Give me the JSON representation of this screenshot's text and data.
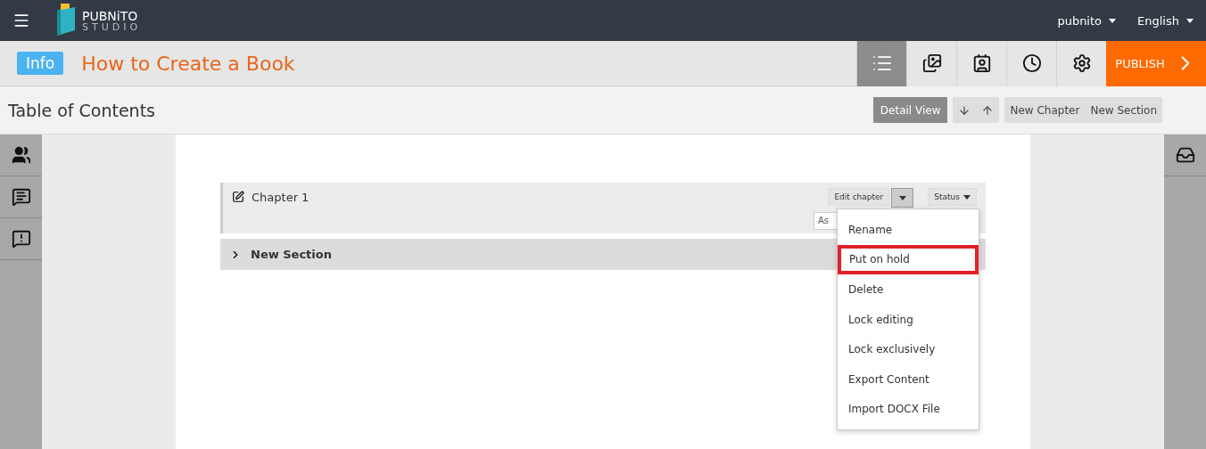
{
  "app": {
    "logo_line1": "PUBNiTO",
    "logo_line2": "STUDIO",
    "user_menu": "pubnito",
    "language_menu": "English"
  },
  "header": {
    "badge": "Info",
    "title": "How to Create a Book",
    "tools": [
      {
        "kind": "list",
        "selected": true
      },
      {
        "kind": "images",
        "selected": false
      },
      {
        "kind": "contacts",
        "selected": false
      },
      {
        "kind": "clock",
        "selected": false
      },
      {
        "kind": "gear",
        "selected": false
      }
    ],
    "publish": "PUBLISH"
  },
  "toolbar": {
    "title": "Table of Contents",
    "view_button": {
      "label": "Detail View",
      "selected": true
    },
    "buttons": [
      "New Chapter",
      "New Section"
    ]
  },
  "left_rail": [
    {
      "kind": "people"
    },
    {
      "kind": "chat"
    },
    {
      "kind": "alert"
    }
  ],
  "right_rail": [
    {
      "kind": "inbox"
    }
  ],
  "chapter": {
    "title": "Chapter 1",
    "edit_button": "Edit chapter",
    "status_button": "Status",
    "field_value": "As"
  },
  "menu": [
    {
      "label": "Rename",
      "highlighted": false
    },
    {
      "label": "Put on hold",
      "highlighted": true
    },
    {
      "label": "Delete",
      "highlighted": false
    },
    {
      "label": "Lock editing",
      "highlighted": false
    },
    {
      "label": "Lock exclusively",
      "highlighted": false
    },
    {
      "label": "Export Content",
      "highlighted": false
    },
    {
      "label": "Import DOCX File",
      "highlighted": false
    }
  ],
  "sections": [
    {
      "title": "New Section",
      "expanded": false
    }
  ]
}
